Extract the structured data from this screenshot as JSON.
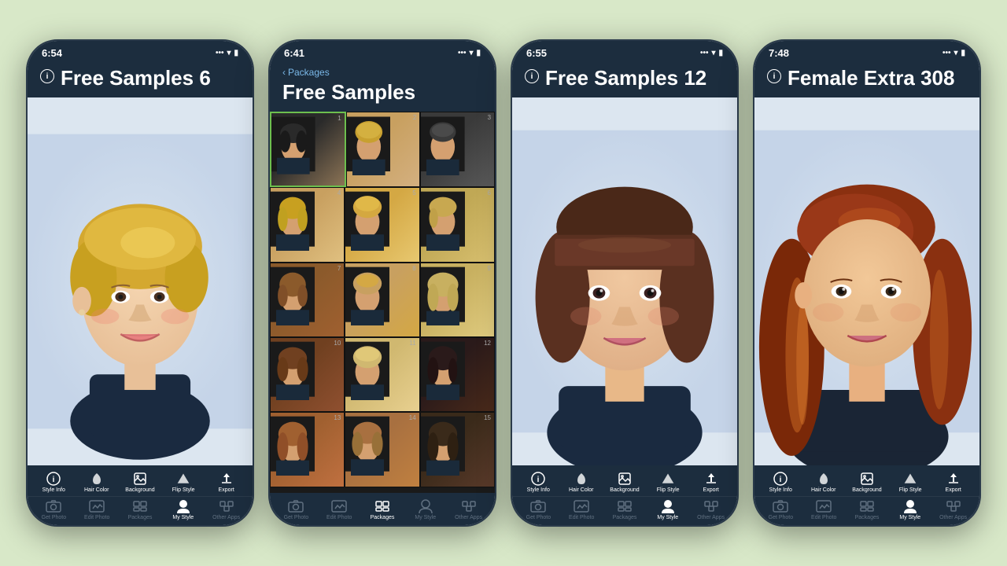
{
  "background_color": "#d8e8c8",
  "phones": [
    {
      "id": "phone1",
      "time": "6:54",
      "title": "Free Samples 6",
      "has_back": false,
      "view": "single",
      "hair_color": "blonde_short",
      "toolbar_top": [
        "Style Info",
        "Hair Color",
        "Background",
        "Flip Style",
        "Export"
      ],
      "toolbar_bottom": [
        "Get Photo",
        "Edit Photo",
        "Packages",
        "My Style",
        "Other Apps"
      ],
      "active_bottom": "My Style"
    },
    {
      "id": "phone2",
      "time": "6:41",
      "title": "Free Samples",
      "has_back": true,
      "back_label": "Packages",
      "view": "grid",
      "selected_cell": 1,
      "grid_count": 15,
      "toolbar_top": [],
      "toolbar_bottom": [
        "Get Photo",
        "Edit Photo",
        "Packages",
        "My Style",
        "Other Apps"
      ],
      "active_bottom": "Packages"
    },
    {
      "id": "phone3",
      "time": "6:55",
      "title": "Free Samples 12",
      "has_back": false,
      "view": "single",
      "hair_color": "brunette_bob",
      "toolbar_top": [
        "Style Info",
        "Hair Color",
        "Background",
        "Flip Style",
        "Export"
      ],
      "toolbar_bottom": [
        "Get Photo",
        "Edit Photo",
        "Packages",
        "My Style",
        "Other Apps"
      ],
      "active_bottom": "My Style"
    },
    {
      "id": "phone4",
      "time": "7:48",
      "title": "Female Extra 308",
      "has_back": false,
      "view": "single",
      "hair_color": "auburn_long",
      "toolbar_top": [
        "Style Info",
        "Hair Color",
        "Background",
        "Flip Style",
        "Export"
      ],
      "toolbar_bottom": [
        "Get Photo",
        "Edit Photo",
        "Packages",
        "My Style",
        "Other Apps"
      ],
      "active_bottom": "My Style"
    }
  ],
  "icons": {
    "info": "ⓘ",
    "back_arrow": "‹",
    "signal": "▪▪▪",
    "wifi": "wifi",
    "battery": "▮"
  }
}
